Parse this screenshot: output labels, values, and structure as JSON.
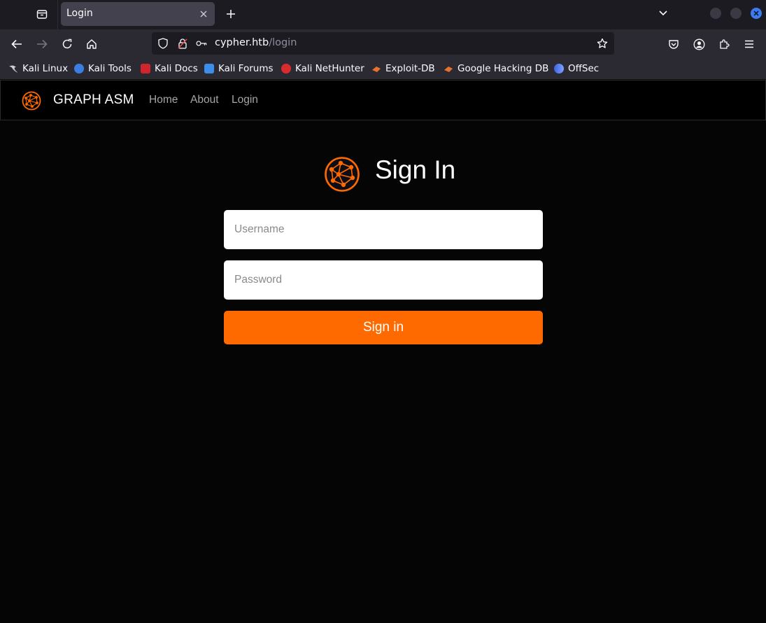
{
  "browser": {
    "tab": {
      "title": "Login"
    },
    "url": {
      "host": "cypher.htb",
      "path": "/login"
    },
    "bookmarks": [
      {
        "label": "Kali Linux",
        "icon": "kali-dragon-icon",
        "color": "#4e9fdc"
      },
      {
        "label": "Kali Tools",
        "icon": "kali-tools-icon",
        "color": "#3b7de0"
      },
      {
        "label": "Kali Docs",
        "icon": "kali-docs-icon",
        "color": "#d0252f"
      },
      {
        "label": "Kali Forums",
        "icon": "kali-forums-icon",
        "color": "#3d8ee8"
      },
      {
        "label": "Kali NetHunter",
        "icon": "nethunter-icon",
        "color": "#d82c2c"
      },
      {
        "label": "Exploit-DB",
        "icon": "exploit-db-icon",
        "color": "#e8722c"
      },
      {
        "label": "Google Hacking DB",
        "icon": "ghdb-icon",
        "color": "#e8722c"
      },
      {
        "label": "OffSec",
        "icon": "offsec-icon",
        "color": "#5a7ff0"
      }
    ]
  },
  "site": {
    "brand": "GRAPH ASM",
    "nav": [
      {
        "label": "Home"
      },
      {
        "label": "About"
      },
      {
        "label": "Login"
      }
    ],
    "accent": "#ff6a00"
  },
  "login": {
    "title": "Sign In",
    "username_placeholder": "Username",
    "password_placeholder": "Password",
    "submit_label": "Sign in"
  }
}
